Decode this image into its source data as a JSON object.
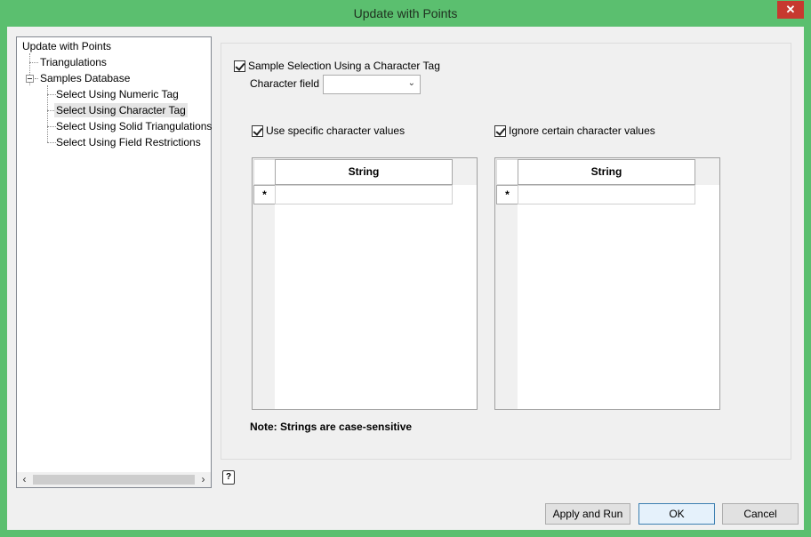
{
  "window": {
    "title": "Update with Points",
    "close_glyph": "✕"
  },
  "tree": {
    "root": "Update with Points",
    "items": [
      {
        "label": "Triangulations"
      },
      {
        "label": "Samples Database"
      },
      {
        "label": "Select Using Numeric Tag"
      },
      {
        "label": "Select Using Character Tag"
      },
      {
        "label": "Select Using Solid Triangulations"
      },
      {
        "label": "Select Using Field Restrictions"
      }
    ],
    "selected": "Select Using Character Tag",
    "scroll_left": "‹",
    "scroll_right": "›"
  },
  "panel": {
    "sample_selection": {
      "label": "Sample Selection Using a Character Tag",
      "checked": true
    },
    "character_field": {
      "label": "Character field",
      "value": "",
      "chevron": "⌄"
    },
    "use_specific": {
      "label": "Use specific character values",
      "checked": true
    },
    "ignore_certain": {
      "label": "Ignore certain character values",
      "checked": true
    },
    "grid_left": {
      "column_header": "String",
      "new_row_marker": "*"
    },
    "grid_right": {
      "column_header": "String",
      "new_row_marker": "*"
    },
    "note": "Note: Strings are case-sensitive"
  },
  "help_icon": "?",
  "buttons": {
    "apply_run": "Apply and Run",
    "ok": "OK",
    "cancel": "Cancel"
  }
}
